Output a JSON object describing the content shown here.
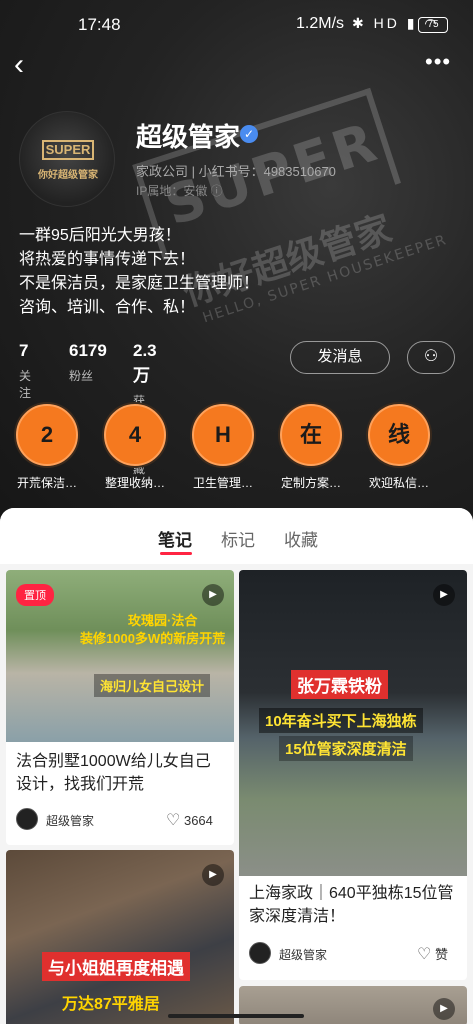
{
  "status_bar": {
    "time": "17:48",
    "speed": "1.2M/s",
    "icons": "✱ HD ▮ ◠",
    "battery": "75"
  },
  "nav": {
    "back_icon": "‹",
    "more_icon": "•••"
  },
  "profile": {
    "avatar_logo": "SUPER",
    "avatar_sub": "你好超级管家",
    "name": "超级管家",
    "verified_icon": "✓",
    "meta_line": "家政公司 | 小红书号：4983510670",
    "ip_line": "IP属地：安徽 ⓘ",
    "bio": [
      "一群95后阳光大男孩！",
      "将热爱的事情传递下去！",
      "不是保洁员，是家庭卫生管理师！",
      "咨询、培训、合作、私！"
    ],
    "watermark": {
      "big": "SUPER",
      "cn": "你好超级管家",
      "en": "HELLO, SUPER HOUSEKEEPER"
    }
  },
  "stats": [
    {
      "num": "7",
      "label": "关注"
    },
    {
      "num": "6179",
      "label": "粉丝"
    },
    {
      "num": "2.3 万",
      "label": "获赞与收藏"
    }
  ],
  "buttons": {
    "message": "发消息",
    "follow_icon": "⚇"
  },
  "highlights": [
    {
      "char": "2",
      "label": "开荒保洁…"
    },
    {
      "char": "4",
      "label": "整理收纳…"
    },
    {
      "char": "H",
      "label": "卫生管理…"
    },
    {
      "char": "在",
      "label": "定制方案…"
    },
    {
      "char": "线",
      "label": "欢迎私信…"
    }
  ],
  "tabs": [
    {
      "label": "笔记"
    },
    {
      "label": "标记"
    },
    {
      "label": "收藏"
    }
  ],
  "notes": [
    {
      "pinned": "置顶",
      "caption1": "玫瑰园·法合",
      "caption2": "装修1000多W的新房开荒",
      "caption3": "海归儿女自己设计",
      "title": "法合别墅1000W给儿女自己设计，找我们开荒",
      "author": "超级管家",
      "likes": "3664",
      "play_icon": "▶"
    },
    {
      "caption1": "张万霖铁粉",
      "caption2": "10年奋斗买下上海独栋",
      "caption3": "15位管家深度清洁",
      "title": "上海家政｜640平独栋15位管家深度清洁！",
      "author": "超级管家",
      "likes": "赞",
      "play_icon": "▶"
    },
    {
      "caption1": "与小姐姐再度相遇",
      "caption2": "万达87平雅居",
      "play_icon": "▶"
    },
    {
      "play_icon": "▶"
    }
  ],
  "heart_icon": "♡"
}
